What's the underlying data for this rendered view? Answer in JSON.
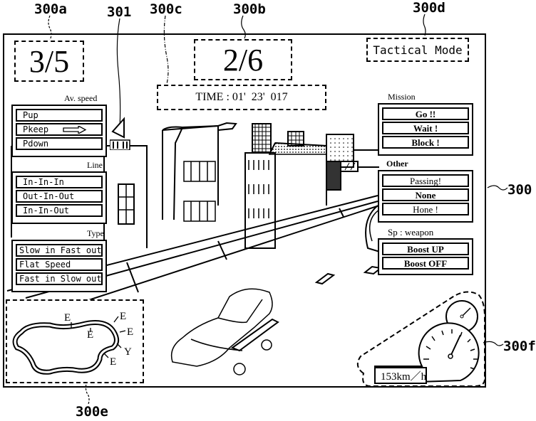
{
  "reference_labels": {
    "screen": "300",
    "lap_counter": "300a",
    "position_counter": "300b",
    "time_display": "300c",
    "mode_display": "300d",
    "course_map": "300e",
    "speedometer": "300f",
    "cursor": "301"
  },
  "hud": {
    "lap": "3/5",
    "position": "2/6",
    "time": "TIME : 01'  23'  017",
    "mode": "Tactical Mode"
  },
  "left_panel": {
    "av_speed": {
      "label": "Av. speed",
      "items": [
        "Pup",
        "Pkeep",
        "Pdown"
      ],
      "selected_index": 1
    },
    "line": {
      "label": "Line",
      "items": [
        "In-In-In",
        "Out-In-Out",
        "In-In-Out"
      ]
    },
    "type": {
      "label": "Type",
      "items": [
        "Slow in Fast out",
        "Flat Speed",
        "Fast in Slow out"
      ]
    }
  },
  "right_panel": {
    "mission": {
      "label": "Mission",
      "items": [
        "Go !!",
        "Wait !",
        "Block !"
      ]
    },
    "other": {
      "label": "Other",
      "items": [
        "Passing!",
        "None",
        "Hone !"
      ]
    },
    "sp_weapon": {
      "label": "Sp : weapon",
      "items": [
        "Boost  UP",
        "Boost  OFF"
      ]
    }
  },
  "course_map": {
    "markers": [
      "E",
      "E",
      "E",
      "E",
      "Y",
      "E"
    ]
  },
  "speedometer": {
    "speed": "153km／h"
  }
}
